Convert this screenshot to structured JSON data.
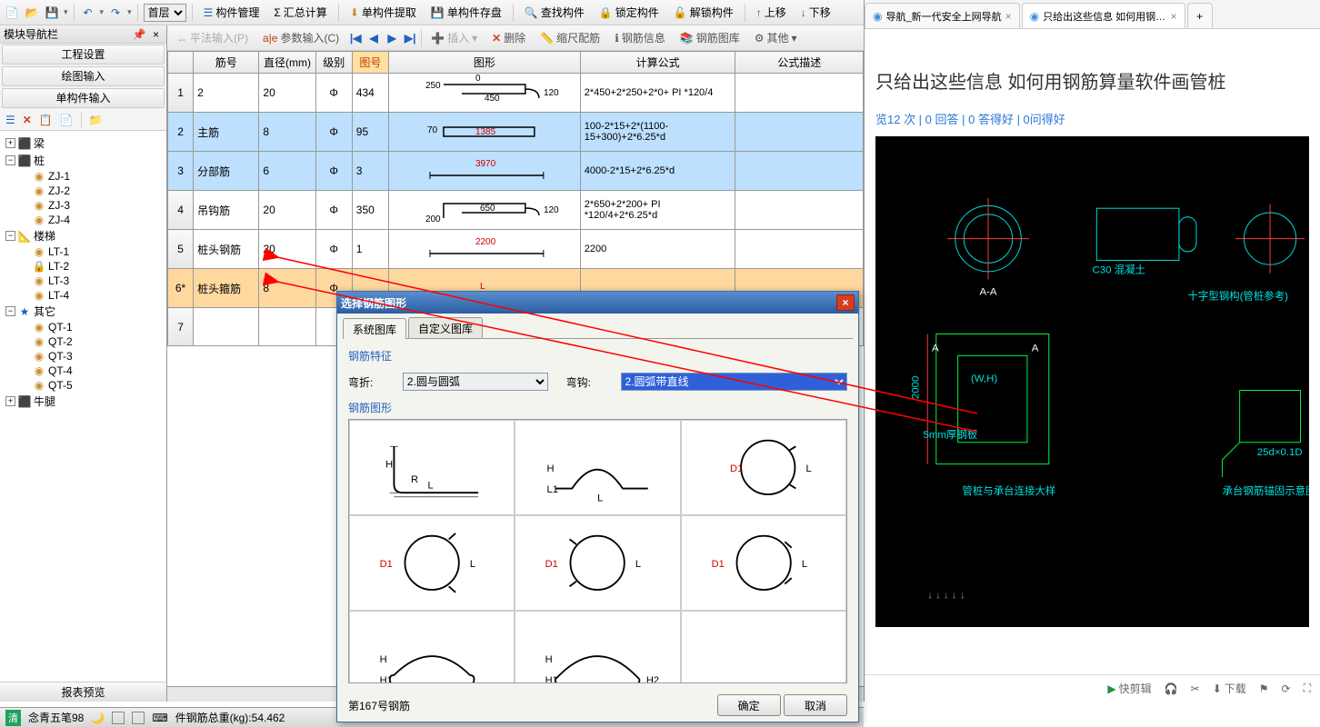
{
  "toolbar1": {
    "floor_select": "首层",
    "buttons": [
      "构件管理",
      "汇总计算",
      "单构件提取",
      "单构件存盘",
      "查找构件",
      "锁定构件",
      "解锁构件",
      "上移",
      "下移"
    ]
  },
  "toolbar2": {
    "input1": "平法输入(P)",
    "input2": "参数输入(C)",
    "insert": "插入",
    "delete": "删除",
    "scale": "缩尺配筋",
    "rebar_info": "钢筋信息",
    "rebar_lib": "钢筋图库",
    "other": "其他"
  },
  "sidebar": {
    "title": "模块导航栏",
    "sections": [
      "工程设置",
      "绘图输入",
      "单构件输入"
    ],
    "footer": "报表预览",
    "tree": [
      {
        "label": "梁",
        "icon": "beam",
        "exp": "+",
        "lvl": 1
      },
      {
        "label": "桩",
        "icon": "pile",
        "exp": "−",
        "lvl": 1
      },
      {
        "label": "ZJ-1",
        "icon": "dot",
        "lvl": 2
      },
      {
        "label": "ZJ-2",
        "icon": "dot",
        "lvl": 2
      },
      {
        "label": "ZJ-3",
        "icon": "dot",
        "lvl": 2
      },
      {
        "label": "ZJ-4",
        "icon": "dot",
        "lvl": 2
      },
      {
        "label": "楼梯",
        "icon": "stair",
        "exp": "−",
        "lvl": 1
      },
      {
        "label": "LT-1",
        "icon": "dot",
        "lvl": 2
      },
      {
        "label": "LT-2",
        "icon": "lock",
        "lvl": 2
      },
      {
        "label": "LT-3",
        "icon": "dot",
        "lvl": 2
      },
      {
        "label": "LT-4",
        "icon": "dot",
        "lvl": 2
      },
      {
        "label": "其它",
        "icon": "star",
        "exp": "−",
        "lvl": 1
      },
      {
        "label": "QT-1",
        "icon": "dot",
        "lvl": 2
      },
      {
        "label": "QT-2",
        "icon": "dot",
        "lvl": 2
      },
      {
        "label": "QT-3",
        "icon": "dot",
        "lvl": 2
      },
      {
        "label": "QT-4",
        "icon": "dot",
        "lvl": 2
      },
      {
        "label": "QT-5",
        "icon": "dot",
        "lvl": 2
      },
      {
        "label": "牛腿",
        "icon": "corbel",
        "exp": "+",
        "lvl": 1
      }
    ]
  },
  "grid": {
    "headers": [
      "",
      "筋号",
      "直径(mm)",
      "级别",
      "图号",
      "图形",
      "计算公式",
      "公式描述"
    ],
    "rows": [
      {
        "n": "1",
        "name": "2",
        "dia": "20",
        "lvl": "Φ",
        "img": "434",
        "shape": {
          "type": "hook",
          "top": "0",
          "mid": "450",
          "left": "250",
          "right": "120"
        },
        "formula": "2*450+2*250+2*0+ PI *120/4",
        "desc": ""
      },
      {
        "n": "2",
        "name": "主筋",
        "dia": "8",
        "lvl": "Φ",
        "img": "95",
        "shape": {
          "type": "bar",
          "mid": "1385",
          "left": "70",
          "red": true
        },
        "formula": "100-2*15+2*(1100-15+300)+2*6.25*d",
        "desc": "",
        "sel": true
      },
      {
        "n": "3",
        "name": "分部筋",
        "dia": "6",
        "lvl": "Φ",
        "img": "3",
        "shape": {
          "type": "line",
          "mid": "3970",
          "red": true
        },
        "formula": "4000-2*15+2*6.25*d",
        "desc": "",
        "sel": true
      },
      {
        "n": "4",
        "name": "吊钩筋",
        "dia": "20",
        "lvl": "Φ",
        "img": "350",
        "shape": {
          "type": "hook2",
          "mid": "650",
          "left": "200",
          "right": "120"
        },
        "formula": "2*650+2*200+ PI *120/4+2*6.25*d",
        "desc": ""
      },
      {
        "n": "5",
        "name": "桩头钢筋",
        "dia": "20",
        "lvl": "Φ",
        "img": "1",
        "shape": {
          "type": "line",
          "mid": "2200",
          "red": true
        },
        "formula": "2200",
        "desc": ""
      },
      {
        "n": "6*",
        "name": "桩头箍筋",
        "dia": "8",
        "lvl": "Φ",
        "img": "",
        "shape": {
          "type": "L",
          "mid": "L",
          "red": true
        },
        "formula": "",
        "desc": "",
        "edit": true
      },
      {
        "n": "7",
        "name": "",
        "dia": "",
        "lvl": "",
        "img": "",
        "shape": {
          "type": "none"
        },
        "formula": "",
        "desc": ""
      }
    ]
  },
  "dialog": {
    "title": "选择钢筋图形",
    "tabs": [
      "系统图库",
      "自定义图库"
    ],
    "section1": "钢筋特征",
    "bend_label": "弯折:",
    "bend_value": "2.圆与圆弧",
    "hook_label": "弯钩:",
    "hook_value": "2.圆弧带直线",
    "section2": "钢筋图形",
    "footer_text": "第167号钢筋",
    "ok": "确定",
    "cancel": "取消"
  },
  "browser": {
    "tabs": [
      {
        "label": "导航_新一代安全上网导航",
        "active": false
      },
      {
        "label": "只给出这些信息 如何用钢筋算量",
        "active": true
      }
    ],
    "page_title": "只给出这些信息 如何用钢筋算量软件画管桩",
    "stats": "览12 次 | 0 回答 | 0 答得好 | 0问得好",
    "bottom": {
      "quickcut": "快剪辑",
      "download": "下载"
    }
  },
  "statusbar": {
    "ime": "清",
    "ime_name": "念青五笔98",
    "text": "件钢筋总重(kg):54.462"
  },
  "cad_labels": {
    "aa": "A-A",
    "c30": "C30 混凝土",
    "cross": "十字型钢构(管桩参考)",
    "detail": "管桩与承台连接大样",
    "anchor": "承台钢筋锚固示意图",
    "dim1": "25d×0.1D",
    "dim2": "5mm厚钢板"
  }
}
